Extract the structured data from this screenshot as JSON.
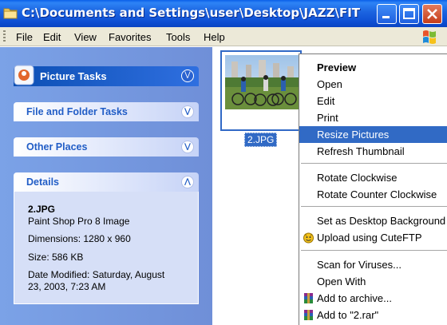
{
  "window": {
    "title": "C:\\Documents and Settings\\user\\Desktop\\JAZZ\\FIT"
  },
  "menu": {
    "items": [
      "File",
      "Edit",
      "View",
      "Favorites",
      "Tools",
      "Help"
    ]
  },
  "task_pane": {
    "picture_tasks": "Picture Tasks",
    "file_folder_tasks": "File and Folder Tasks",
    "other_places": "Other Places",
    "details": {
      "heading": "Details",
      "filename": "2.JPG",
      "type": "Paint Shop Pro 8 Image",
      "dimensions": "Dimensions: 1280 x 960",
      "size": "Size: 586 KB",
      "modified_line1": "Date Modified: Saturday, August",
      "modified_line2": "23, 2003, 7:23 AM"
    }
  },
  "file": {
    "label": "2.JPG"
  },
  "context_menu": {
    "items": [
      "Preview",
      "Open",
      "Edit",
      "Print",
      "Resize Pictures",
      "Refresh Thumbnail",
      "Rotate Clockwise",
      "Rotate Counter Clockwise",
      "Set as Desktop Background",
      "Upload using CuteFTP",
      "Scan for Viruses...",
      "Open With",
      "Add to archive...",
      "Add to \"2.rar\""
    ],
    "highlighted": "Resize Pictures"
  },
  "icons": {
    "folder": "folder-icon",
    "windows_logo": "windows-logo-icon",
    "picture_tasks": "picture-tasks-icon",
    "cuteftp": "cuteftp-icon",
    "winrar": "winrar-icon"
  },
  "colors": {
    "titlebar": "#0e4fd3",
    "taskpane": "#7ba2e7",
    "selection": "#316ac5"
  }
}
